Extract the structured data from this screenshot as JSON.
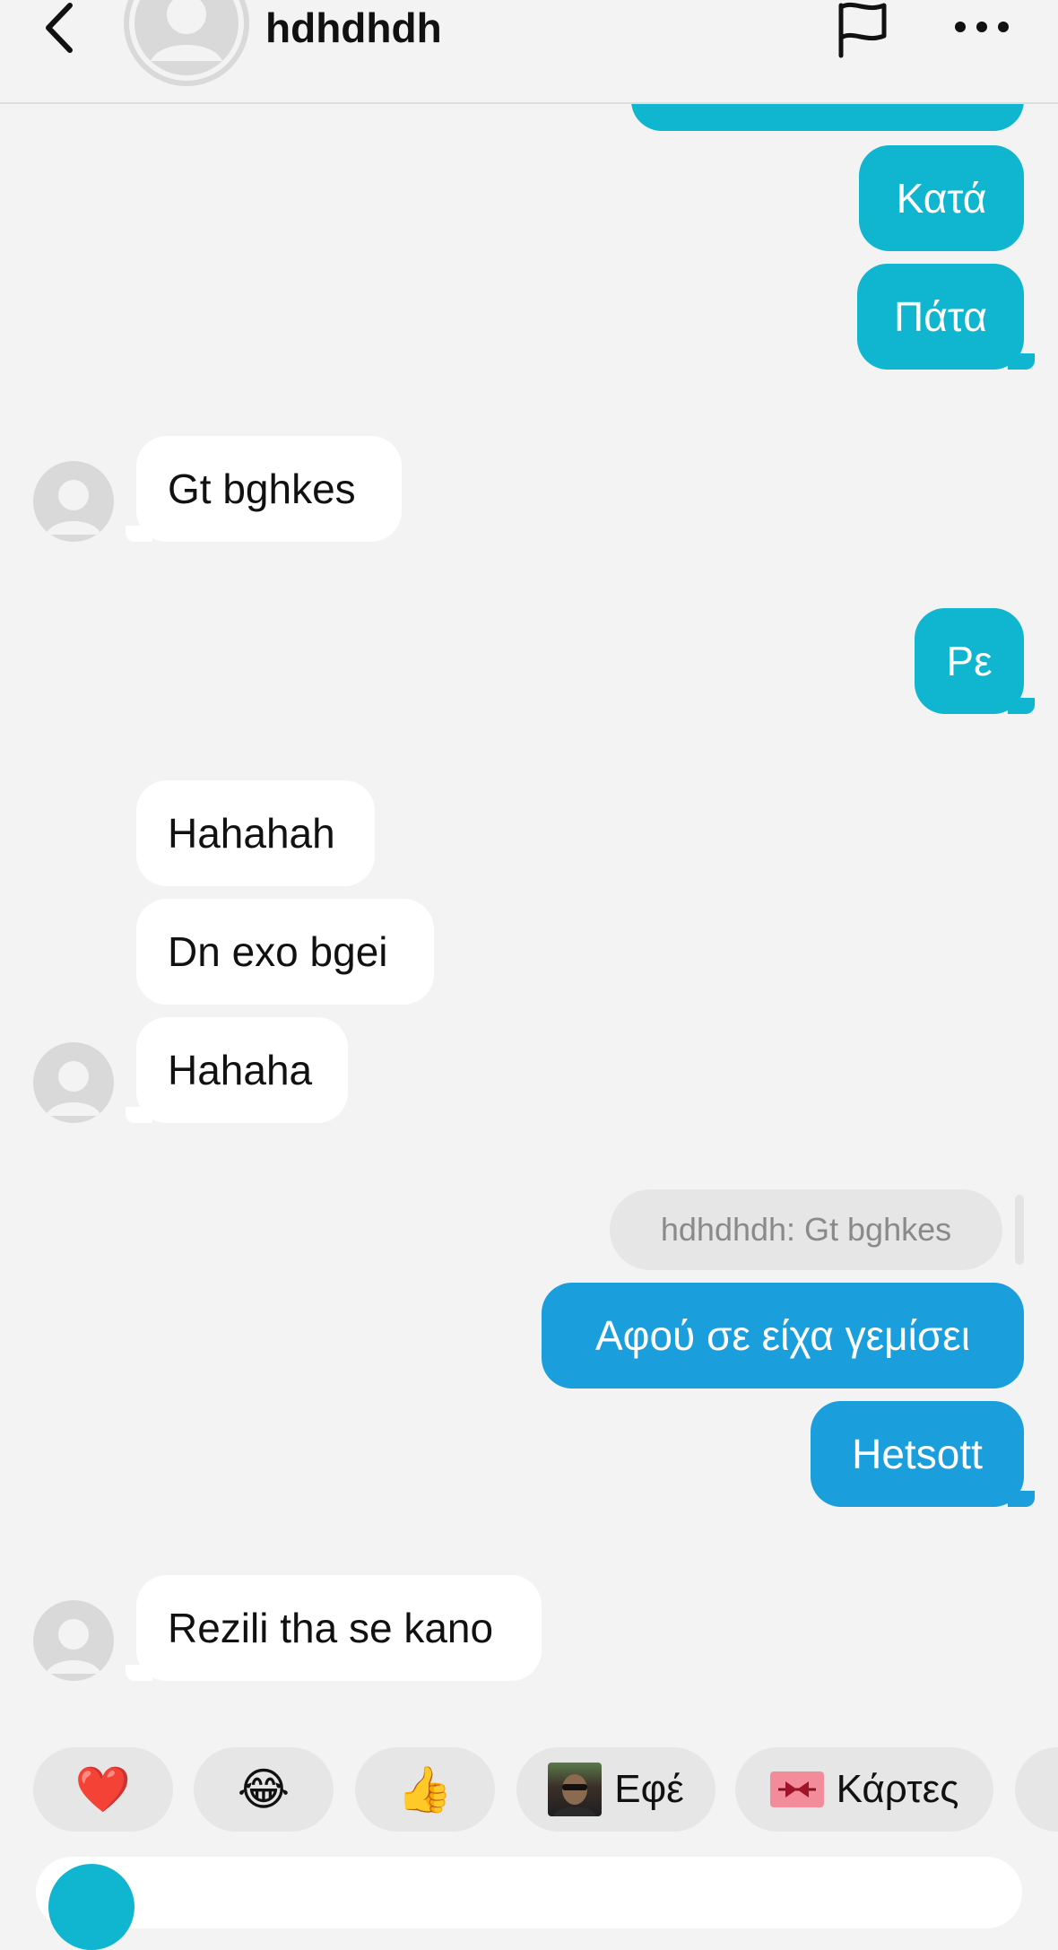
{
  "header": {
    "title": "hdhdhdh"
  },
  "messages": [
    {
      "id": "m1",
      "from": "me",
      "text": "Κατά"
    },
    {
      "id": "m2",
      "from": "me",
      "text": "Πάτα"
    },
    {
      "id": "m3",
      "from": "them",
      "text": "Gt bghkes"
    },
    {
      "id": "m4",
      "from": "me",
      "text": "Ρε"
    },
    {
      "id": "m5",
      "from": "them",
      "text": "Hahahah"
    },
    {
      "id": "m6",
      "from": "them",
      "text": "Dn exo bgei"
    },
    {
      "id": "m7",
      "from": "them",
      "text": "Hahaha"
    },
    {
      "id": "m8",
      "from": "me",
      "text": "Αφού σε είχα γεμίσει"
    },
    {
      "id": "m9",
      "from": "me",
      "text": "Hetsott"
    },
    {
      "id": "m10",
      "from": "them",
      "text": "Rezili tha se kano"
    }
  ],
  "reply_quote": {
    "text": "hdhdhdh: Gt bghkes"
  },
  "quick_reactions": [
    {
      "emoji": "❤️",
      "label": ""
    },
    {
      "emoji": "😂",
      "label": ""
    },
    {
      "emoji": "👍",
      "label": ""
    },
    {
      "icon": "selfie-thumbnail",
      "label": "Εφέ"
    },
    {
      "icon": "gift-card-icon",
      "label": "Κάρτες"
    }
  ],
  "colors": {
    "outgoing_bubble": "#10b6cf",
    "outgoing_bubble_alt": "#1a9fdc",
    "incoming_bubble": "#ffffff",
    "background": "#f3f3f3"
  }
}
